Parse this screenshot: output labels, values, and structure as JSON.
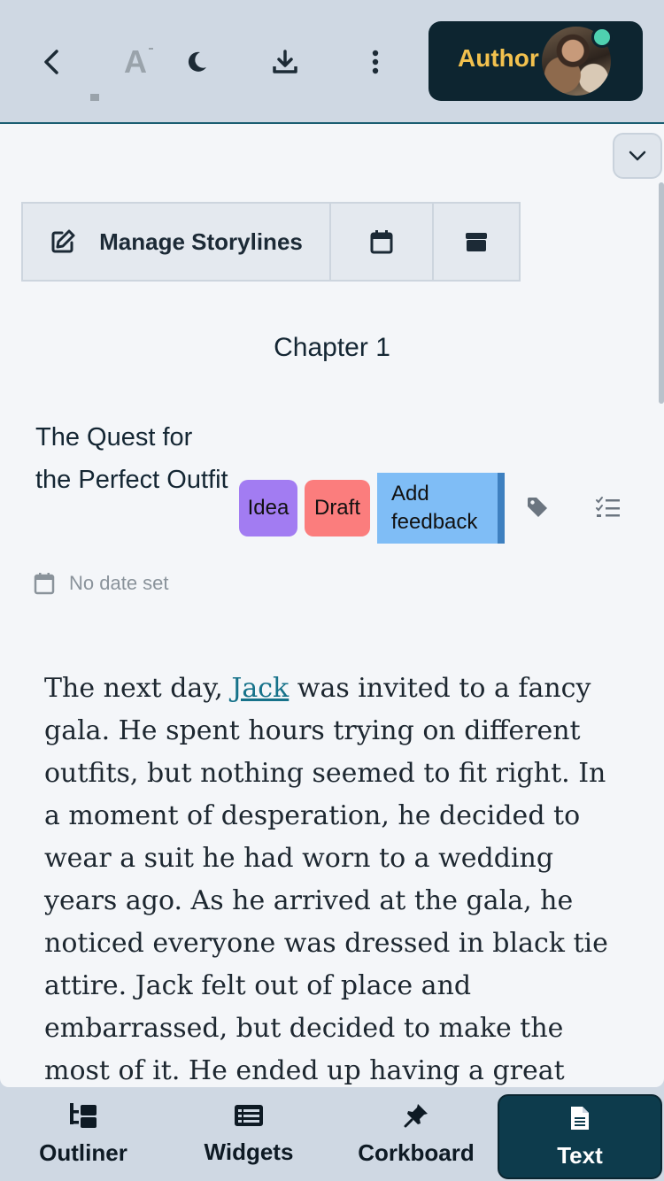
{
  "toolbar": {
    "back_icon": "chevron-left-icon",
    "font_icon": "font-size-icon",
    "font_glyph": "A",
    "theme_icon": "moon-icon",
    "download_icon": "download-icon",
    "more_icon": "more-vertical-icon",
    "author_label": "Author"
  },
  "panel": {
    "storylines_label": "Manage Storylines",
    "chapter_title": "Chapter 1",
    "scene": {
      "title": "The Quest for the Perfect Outfit",
      "status_idea": "Idea",
      "status_draft": "Draft",
      "feedback_label": "Add feedback",
      "date_text": "No date set"
    },
    "body": {
      "pre_link": "The next day, ",
      "link_text": "Jack",
      "post_link": " was invited to a fancy gala. He spent hours trying on different outfits, but nothing seemed to fit right. In a moment of desperation, he decided to wear a suit he had worn to a wedding years ago. As he arrived at the gala, he noticed everyone was dressed in black tie attire. Jack felt out of place and embarrassed, but decided to make the most of it. He ended up having a great"
    }
  },
  "colors": {
    "idea": "#a27cf2",
    "draft": "#fb7d7d",
    "feedback": "#7fbdf6",
    "author_text": "#f2c14e",
    "active_nav": "#0d3b4c"
  },
  "nav": {
    "outliner": "Outliner",
    "widgets": "Widgets",
    "corkboard": "Corkboard",
    "text": "Text",
    "active": "Text"
  }
}
